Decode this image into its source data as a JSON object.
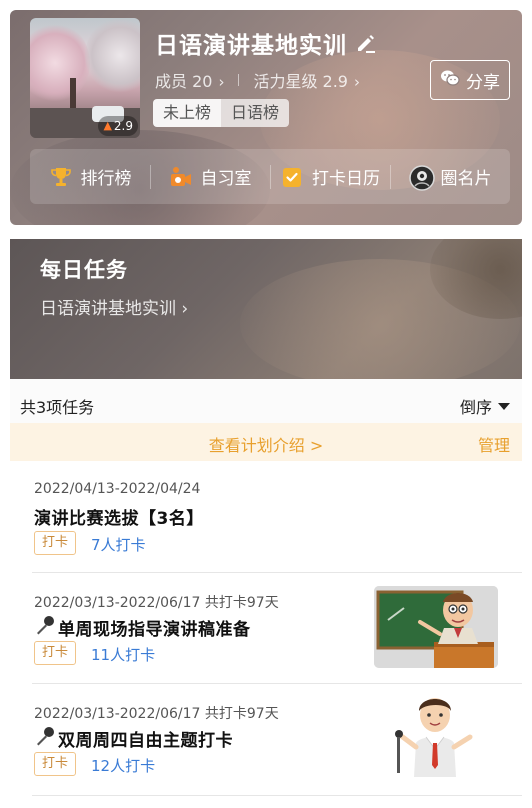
{
  "group": {
    "title": "日语演讲基地实训",
    "cover_badge": "2.9",
    "members_label": "成员 20",
    "level_label": "活力星级 2.9",
    "rank_tag_1": "未上榜",
    "rank_tag_2": "日语榜",
    "share_label": "分享",
    "chevron": "›",
    "quick_actions": [
      {
        "label": "排行榜",
        "icon": "trophy-icon"
      },
      {
        "label": "自习室",
        "icon": "study-room-icon"
      },
      {
        "label": "打卡日历",
        "icon": "calendar-check-icon"
      },
      {
        "label": "圈名片",
        "icon": "card-avatar-icon"
      }
    ]
  },
  "daily_task": {
    "title": "每日任务",
    "subtitle": "日语演讲基地实训 ›"
  },
  "list": {
    "count_label": "共3项任务",
    "order_label": "倒序",
    "plan_link": "查看计划介绍 >",
    "manage_label": "管理"
  },
  "tasks": [
    {
      "date": "2022/04/13-2022/04/24",
      "name": "演讲比赛选拔【3名】",
      "tag": "打卡",
      "count": "7人打卡",
      "has_mic": false,
      "thumb": null
    },
    {
      "date": "2022/03/13-2022/06/17  共打卡97天",
      "name": "单周现场指导演讲稿准备",
      "tag": "打卡",
      "count": "11人打卡",
      "has_mic": true,
      "thumb": "teacher-blackboard"
    },
    {
      "date": "2022/03/13-2022/06/17  共打卡97天",
      "name": "双周周四自由主题打卡",
      "tag": "打卡",
      "count": "12人打卡",
      "has_mic": true,
      "thumb": "speaker-with-mic"
    }
  ],
  "colors": {
    "accent_orange": "#e8a02e",
    "link_blue": "#3a7bd5",
    "plan_bar_bg": "#fdf3e3"
  }
}
